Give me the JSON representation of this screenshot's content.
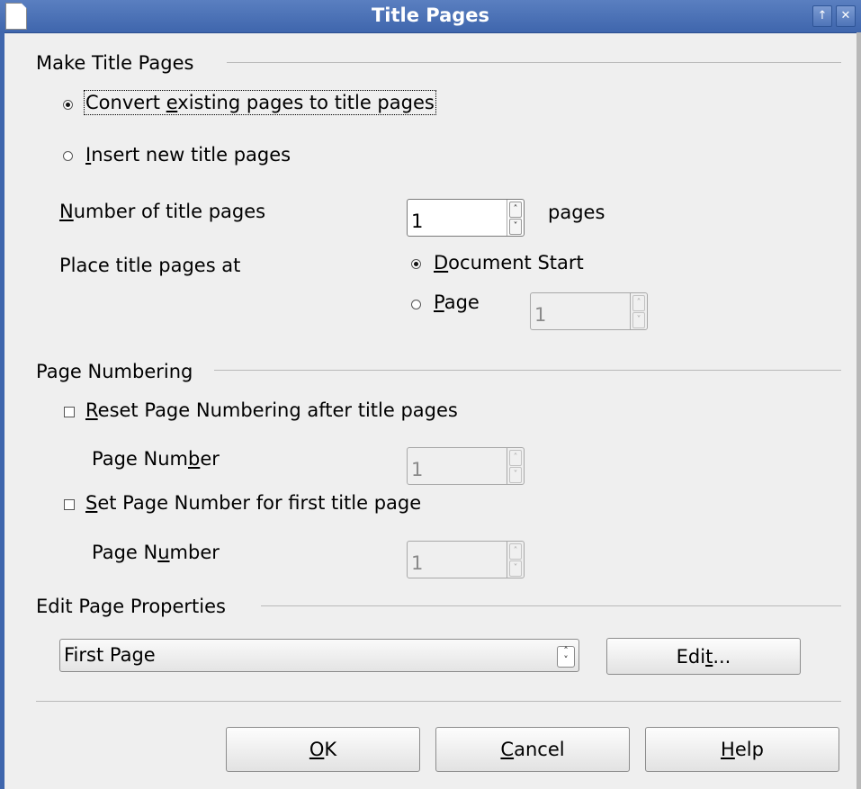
{
  "window": {
    "title": "Title Pages",
    "icons": [
      "document-icon",
      "up-arrow-icon",
      "close-icon"
    ]
  },
  "make": {
    "header": "Make Title Pages",
    "convert_pre": "Convert ",
    "convert_key": "e",
    "convert_post": "xisting pages to title pages",
    "insert_key": "I",
    "insert_post": "nsert new title pages",
    "num_key": "N",
    "num_post": "umber of title pages",
    "num_value": "1",
    "pages_unit": "pages",
    "place_label": "Place title pages at",
    "docstart_key": "D",
    "docstart_post": "ocument Start",
    "page_key": "P",
    "page_post": "age",
    "page_value": "1"
  },
  "numbering": {
    "header": "Page Numbering",
    "reset_key": "R",
    "reset_post": "eset Page Numbering after title pages",
    "pn1_pre": "Page Num",
    "pn1_key": "b",
    "pn1_post": "er",
    "pn1_value": "1",
    "set_key": "S",
    "set_post": "et Page Number for first title page",
    "pn2_pre": "Page N",
    "pn2_key": "u",
    "pn2_post": "mber",
    "pn2_value": "1"
  },
  "props": {
    "header": "Edit Page Properties",
    "combo_value": "First Page",
    "edit_pre": "Edi",
    "edit_key": "t",
    "edit_post": "..."
  },
  "buttons": {
    "ok_key": "O",
    "ok_post": "K",
    "cancel_key": "C",
    "cancel_post": "ancel",
    "help_key": "H",
    "help_post": "elp"
  }
}
